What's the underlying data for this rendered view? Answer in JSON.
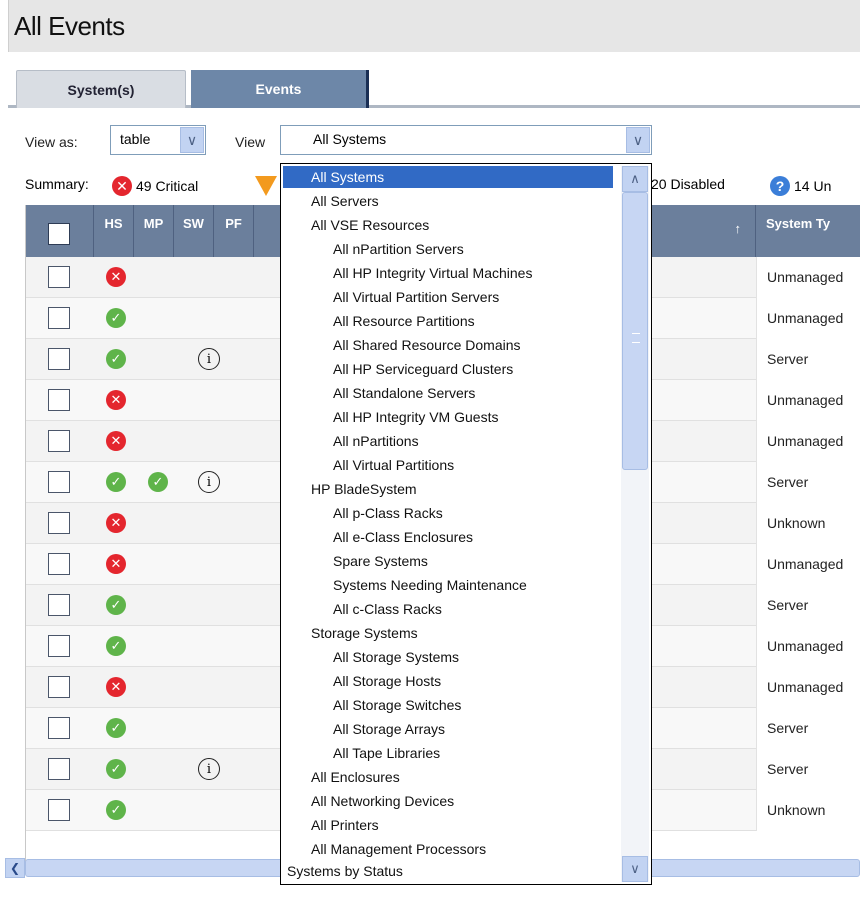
{
  "page": {
    "title": "All Events"
  },
  "tabs": [
    {
      "label": "System(s)",
      "active": true
    },
    {
      "label": "Events",
      "active": false
    }
  ],
  "view_as": {
    "label": "View as:",
    "value": "table"
  },
  "view": {
    "label": "View",
    "value": "All Systems"
  },
  "summary": {
    "label": "Summary:",
    "critical": "49 Critical",
    "disabled": "20 Disabled",
    "unknown": "14 Un"
  },
  "table": {
    "columns": [
      "HS",
      "MP",
      "SW",
      "PF",
      "System Ty"
    ],
    "sort_arrow": "↑",
    "rows": [
      {
        "hs": "crit",
        "mp": "",
        "sw": false,
        "type": "Unmanaged"
      },
      {
        "hs": "ok",
        "mp": "",
        "sw": false,
        "type": "Unmanaged"
      },
      {
        "hs": "ok",
        "mp": "",
        "sw": true,
        "type": "Server"
      },
      {
        "hs": "crit",
        "mp": "",
        "sw": false,
        "type": "Unmanaged"
      },
      {
        "hs": "crit",
        "mp": "",
        "sw": false,
        "type": "Unmanaged"
      },
      {
        "hs": "ok",
        "mp": "ok",
        "sw": true,
        "type": "Server"
      },
      {
        "hs": "crit",
        "mp": "",
        "sw": false,
        "type": "Unknown"
      },
      {
        "hs": "crit",
        "mp": "",
        "sw": false,
        "type": "Unmanaged"
      },
      {
        "hs": "ok",
        "mp": "",
        "sw": false,
        "type": "Server"
      },
      {
        "hs": "ok",
        "mp": "",
        "sw": false,
        "type": "Unmanaged"
      },
      {
        "hs": "crit",
        "mp": "",
        "sw": false,
        "type": "Unmanaged"
      },
      {
        "hs": "ok",
        "mp": "",
        "sw": false,
        "type": "Server"
      },
      {
        "hs": "ok",
        "mp": "",
        "sw": true,
        "type": "Server"
      },
      {
        "hs": "ok",
        "mp": "",
        "sw": false,
        "type": "Unknown"
      }
    ]
  },
  "dropdown_options": [
    {
      "label": "All Systems",
      "level": 0,
      "selected": true
    },
    {
      "label": "All Servers",
      "level": 0
    },
    {
      "label": "All VSE Resources",
      "level": 0
    },
    {
      "label": "All nPartition Servers",
      "level": 1
    },
    {
      "label": "All HP Integrity Virtual Machines",
      "level": 1
    },
    {
      "label": "All Virtual Partition Servers",
      "level": 1
    },
    {
      "label": "All Resource Partitions",
      "level": 1
    },
    {
      "label": "All Shared Resource Domains",
      "level": 1
    },
    {
      "label": "All HP Serviceguard Clusters",
      "level": 1
    },
    {
      "label": "All Standalone Servers",
      "level": 1
    },
    {
      "label": "All HP Integrity VM Guests",
      "level": 1
    },
    {
      "label": "All nPartitions",
      "level": 1
    },
    {
      "label": "All Virtual Partitions",
      "level": 1
    },
    {
      "label": "HP BladeSystem",
      "level": 0
    },
    {
      "label": "All p-Class Racks",
      "level": 1
    },
    {
      "label": "All e-Class Enclosures",
      "level": 1
    },
    {
      "label": "Spare Systems",
      "level": 1
    },
    {
      "label": "Systems Needing Maintenance",
      "level": 1
    },
    {
      "label": "All c-Class Racks",
      "level": 1
    },
    {
      "label": "Storage Systems",
      "level": 0
    },
    {
      "label": "All Storage Systems",
      "level": 1
    },
    {
      "label": "All Storage Hosts",
      "level": 1
    },
    {
      "label": "All Storage Switches",
      "level": 1
    },
    {
      "label": "All Storage Arrays",
      "level": 1
    },
    {
      "label": "All Tape Libraries",
      "level": 1
    },
    {
      "label": "All Enclosures",
      "level": 0
    },
    {
      "label": "All Networking Devices",
      "level": 0
    },
    {
      "label": "All Printers",
      "level": 0
    },
    {
      "label": "All Management Processors",
      "level": 0
    },
    {
      "label": "Systems by Status",
      "level": -1
    }
  ],
  "colors": {
    "header_bg": "#6b7f9c",
    "selected_option": "#316ac5",
    "critical": "#e4262e",
    "ok": "#5fb44a"
  }
}
